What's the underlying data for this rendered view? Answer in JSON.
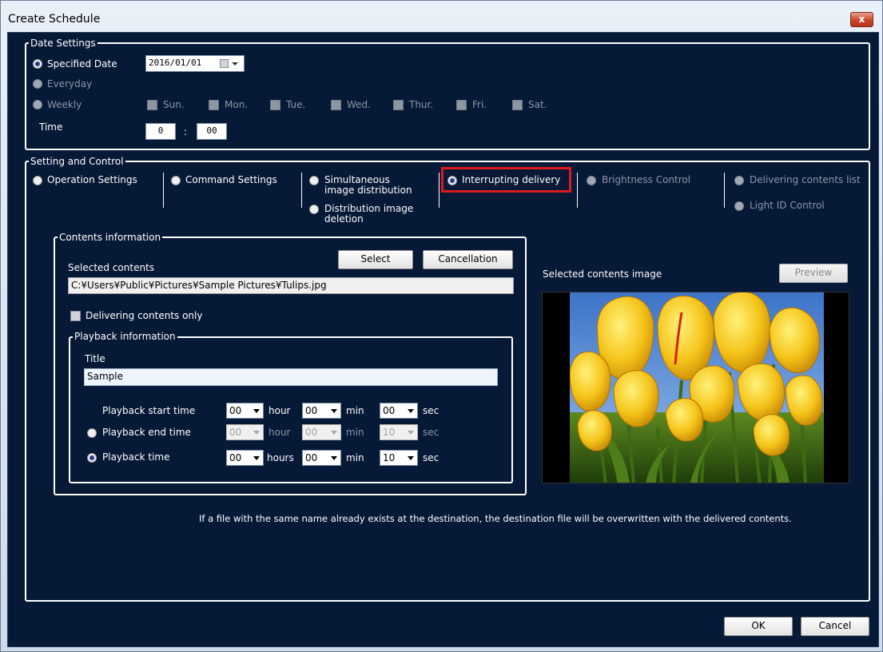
{
  "window": {
    "title": "Create Schedule",
    "close_label": "x"
  },
  "date_settings": {
    "group_title": "Date Settings",
    "specified_date_label": "Specified Date",
    "date_value": "2016/01/01",
    "everyday_label": "Everyday",
    "weekly_label": "Weekly",
    "days": [
      "Sun.",
      "Mon.",
      "Tue.",
      "Wed.",
      "Thur.",
      "Fri.",
      "Sat."
    ],
    "time_label": "Time",
    "time_hour": "0",
    "time_sep": ":",
    "time_min": "00"
  },
  "setting_control": {
    "group_title": "Setting and Control",
    "operation_settings": "Operation Settings",
    "command_settings": "Command Settings",
    "simultaneous_line1": "Simultaneous",
    "simultaneous_line2": "image distribution",
    "deletion_line1": "Distribution image",
    "deletion_line2": "deletion",
    "interrupting_delivery": "Interrupting delivery",
    "brightness_control": "Brightness Control",
    "delivering_contents_list": "Delivering contents list",
    "light_id_control": "Light ID Control"
  },
  "contents_info": {
    "group_title": "Contents information",
    "select_button": "Select",
    "cancellation_button": "Cancellation",
    "selected_contents_label": "Selected contents",
    "selected_path": "C:¥Users¥Public¥Pictures¥Sample Pictures¥Tulips.jpg",
    "delivering_only_label": "Delivering contents only"
  },
  "playback": {
    "group_title": "Playback information",
    "title_label": "Title",
    "title_value": "Sample",
    "start_label": "Playback start time",
    "end_label": "Playback end time",
    "duration_label": "Playback time",
    "start": {
      "hour": "00",
      "min": "00",
      "sec": "00",
      "hour_unit": "hour",
      "min_unit": "min",
      "sec_unit": "sec"
    },
    "end": {
      "hour": "00",
      "min": "00",
      "sec": "10",
      "hour_unit": "hour",
      "min_unit": "min",
      "sec_unit": "sec"
    },
    "duration": {
      "hour": "00",
      "min": "00",
      "sec": "10",
      "hour_unit": "hours",
      "min_unit": "min",
      "sec_unit": "sec"
    }
  },
  "image_panel": {
    "label": "Selected contents image",
    "preview_button": "Preview"
  },
  "notice": "If a file with the same name already exists at the destination, the destination file will be overwritten with the delivered contents.",
  "footer": {
    "ok_button": "OK",
    "cancel_button": "Cancel"
  },
  "colors": {
    "background": "#061936",
    "highlight": "#e0191f",
    "tulip": "#f2b705"
  }
}
